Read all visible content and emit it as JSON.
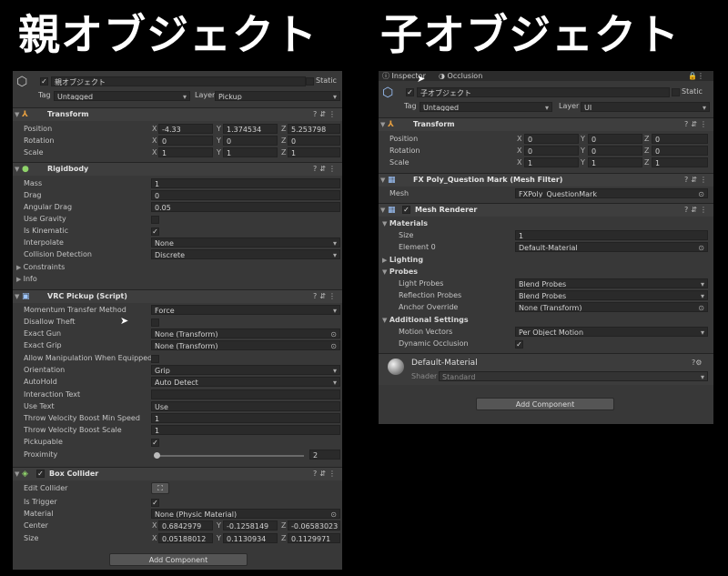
{
  "headings": {
    "parent": "親オブジェクト",
    "child": "子オブジェクト"
  },
  "parent": {
    "object_name": "親オブジェクト",
    "static_label": "Static",
    "tag_label": "Tag",
    "tag_value": "Untagged",
    "layer_label": "Layer",
    "layer_value": "Pickup",
    "transform": {
      "title": "Transform",
      "position_label": "Position",
      "rotation_label": "Rotation",
      "scale_label": "Scale",
      "position": [
        "-4.33",
        "1.374534",
        "5.253798"
      ],
      "rotation": [
        "0",
        "0",
        "0"
      ],
      "scale": [
        "1",
        "1",
        "1"
      ]
    },
    "rigidbody": {
      "title": "Rigidbody",
      "mass_label": "Mass",
      "mass": "1",
      "drag_label": "Drag",
      "drag": "0",
      "angular_drag_label": "Angular Drag",
      "angular_drag": "0.05",
      "use_gravity_label": "Use Gravity",
      "is_kinematic_label": "Is Kinematic",
      "interpolate_label": "Interpolate",
      "interpolate": "None",
      "collision_label": "Collision Detection",
      "collision": "Discrete",
      "constraints_label": "Constraints",
      "info_label": "Info"
    },
    "pickup": {
      "title": "VRC Pickup (Script)",
      "momentum_label": "Momentum Transfer Method",
      "momentum": "Force",
      "disallow_theft_label": "Disallow Theft",
      "exact_gun_label": "Exact Gun",
      "exact_gun": "None (Transform)",
      "exact_grip_label": "Exact Grip",
      "exact_grip": "None (Transform)",
      "allow_manip_label": "Allow Manipulation When Equipped",
      "orientation_label": "Orientation",
      "orientation": "Grip",
      "autohold_label": "AutoHold",
      "autohold": "Auto Detect",
      "interaction_text_label": "Interaction Text",
      "interaction_text": "",
      "use_text_label": "Use Text",
      "use_text": "Use",
      "tvb_min_label": "Throw Velocity Boost Min Speed",
      "tvb_min": "1",
      "tvb_scale_label": "Throw Velocity Boost Scale",
      "tvb_scale": "1",
      "pickupable_label": "Pickupable",
      "proximity_label": "Proximity",
      "proximity": "2"
    },
    "box_collider": {
      "title": "Box Collider",
      "edit_collider_label": "Edit Collider",
      "is_trigger_label": "Is Trigger",
      "material_label": "Material",
      "material": "None (Physic Material)",
      "center_label": "Center",
      "center": [
        "0.6842979",
        "-0.1258149",
        "-0.06583023"
      ],
      "size_label": "Size",
      "size": [
        "0.05188012",
        "0.1130934",
        "0.1129971"
      ]
    },
    "add_component": "Add Component"
  },
  "child": {
    "tab_inspector": "Inspector",
    "tab_occlusion": "Occlusion",
    "object_name": "子オブジェクト",
    "static_label": "Static",
    "tag_label": "Tag",
    "tag_value": "Untagged",
    "layer_label": "Layer",
    "layer_value": "UI",
    "transform": {
      "title": "Transform",
      "position_label": "Position",
      "rotation_label": "Rotation",
      "scale_label": "Scale",
      "position": [
        "0",
        "0",
        "0"
      ],
      "rotation": [
        "0",
        "0",
        "0"
      ],
      "scale": [
        "1",
        "1",
        "1"
      ]
    },
    "mesh_filter": {
      "title": "FX Poly_Question Mark (Mesh Filter)",
      "mesh_label": "Mesh",
      "mesh": "FXPoly_QuestionMark"
    },
    "mesh_renderer": {
      "title": "Mesh Renderer",
      "materials_label": "Materials",
      "size_label": "Size",
      "size": "1",
      "element0_label": "Element 0",
      "element0": "Default-Material",
      "lighting_label": "Lighting",
      "probes_label": "Probes",
      "light_probes_label": "Light Probes",
      "light_probes": "Blend Probes",
      "reflection_probes_label": "Reflection Probes",
      "reflection_probes": "Blend Probes",
      "anchor_override_label": "Anchor Override",
      "anchor_override": "None (Transform)",
      "additional_label": "Additional Settings",
      "motion_vectors_label": "Motion Vectors",
      "motion_vectors": "Per Object Motion",
      "dynamic_occlusion_label": "Dynamic Occlusion"
    },
    "material": {
      "name": "Default-Material",
      "shader_label": "Shader",
      "shader": "Standard"
    },
    "add_component": "Add Component"
  }
}
